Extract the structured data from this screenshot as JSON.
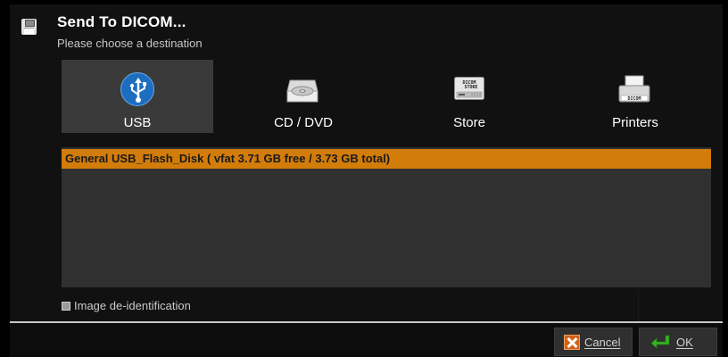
{
  "dialog": {
    "title": "Send To DICOM...",
    "subtitle": "Please choose a destination",
    "title_icon": "floppy-disk-icon"
  },
  "tabs": [
    {
      "label": "USB",
      "icon": "usb-icon",
      "active": true
    },
    {
      "label": "CD / DVD",
      "icon": "cd-dvd-drive-icon",
      "active": false
    },
    {
      "label": "Store",
      "icon": "dicom-store-icon",
      "active": false
    },
    {
      "label": "Printers",
      "icon": "dicom-printer-icon",
      "active": false
    }
  ],
  "icon_text": {
    "store": [
      "DICOM",
      "STORE"
    ],
    "printer": "DICOM"
  },
  "devices": [
    {
      "label": "General USB_Flash_Disk ( vfat 3.71 GB free / 3.73 GB total)",
      "selected": true
    }
  ],
  "options": {
    "deidentify_label": "Image de-identification",
    "deidentify_checked": false
  },
  "buttons": {
    "cancel_label": "Cancel",
    "ok_label": "OK"
  },
  "colors": {
    "selection": "#d27c0a",
    "background": "#111111",
    "list_background": "#303030",
    "usb_blue": "#1d6ec0"
  }
}
